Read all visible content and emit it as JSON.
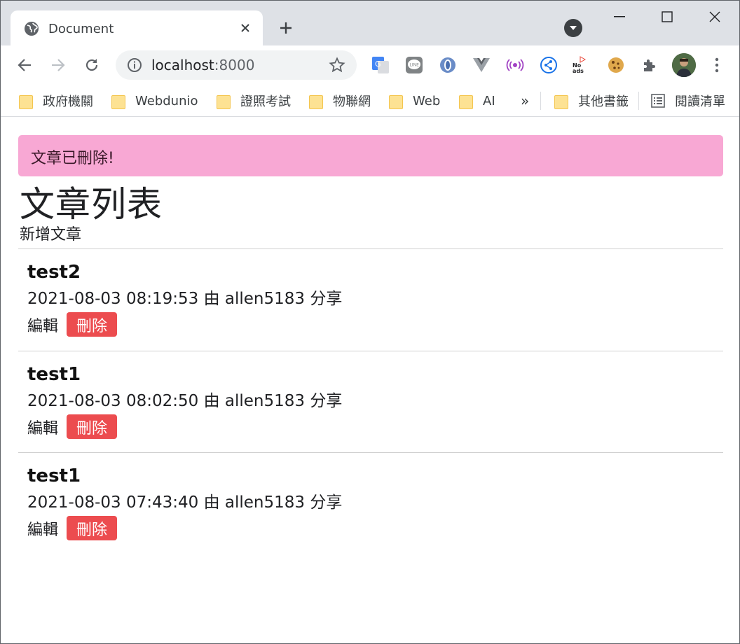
{
  "browser": {
    "tab_title": "Document",
    "url_host": "localhost",
    "url_port": ":8000",
    "bookmarks": [
      {
        "label": "政府機關"
      },
      {
        "label": "Webdunio"
      },
      {
        "label": "證照考試"
      },
      {
        "label": "物聯網"
      },
      {
        "label": "Web"
      },
      {
        "label": "AI"
      }
    ],
    "bookmarks_overflow": "»",
    "other_bookmarks": "其他書籤",
    "reading_list": "閱讀清單",
    "ext_noads_label": "No ads"
  },
  "page": {
    "alert": "文章已刪除!",
    "title": "文章列表",
    "new_post_link": "新增文章",
    "posts": [
      {
        "title": "test2",
        "meta": "2021-08-03 08:19:53 由 allen5183 分享",
        "edit": "編輯",
        "delete": "刪除"
      },
      {
        "title": "test1",
        "meta": "2021-08-03 08:02:50 由 allen5183 分享",
        "edit": "編輯",
        "delete": "刪除"
      },
      {
        "title": "test1",
        "meta": "2021-08-03 07:43:40 由 allen5183 分享",
        "edit": "編輯",
        "delete": "刪除"
      }
    ]
  },
  "colors": {
    "alert_bg": "#f8a8d4",
    "delete_button": "#ec4c4f",
    "chrome_frame": "#dee1e6"
  }
}
